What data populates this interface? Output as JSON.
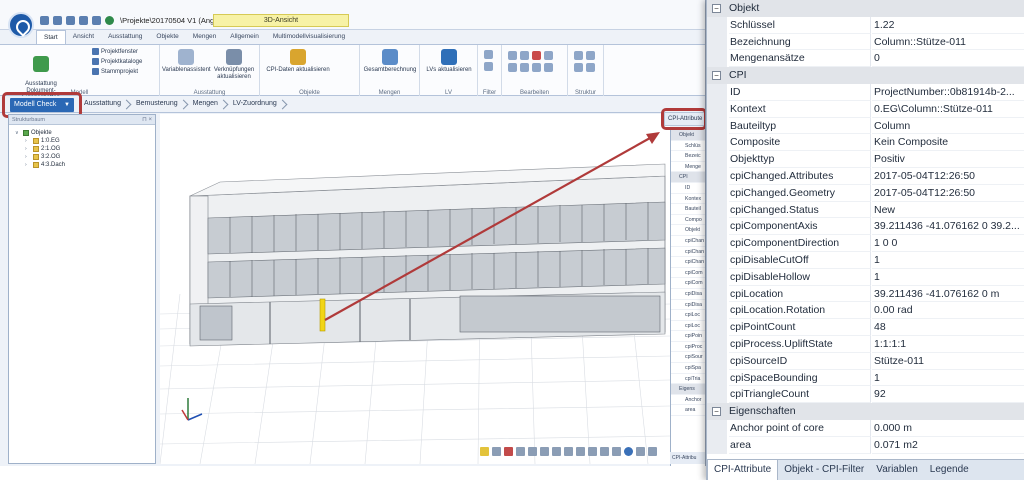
{
  "window": {
    "doc_title": "\\Projekte\\20170504 V1 (Ang...",
    "context_tab": "3D-Ansicht"
  },
  "ribbon": {
    "tabs": [
      "Start",
      "Ansicht",
      "Ausstattung",
      "Objekte",
      "Mengen",
      "Allgemein",
      "Multimodellvisualisierung"
    ],
    "groups": {
      "modell": {
        "label": "Modell",
        "big_button": "Ausstattung\nDokument-Eigenschaften",
        "small": [
          "Projektfenster",
          "Projektkataloge",
          "Stammprojekt"
        ]
      },
      "ausstattung": {
        "label": "Ausstattung",
        "buttons": [
          "Variablenassistent",
          "Verknüpfungen aktualisieren"
        ]
      },
      "objekte": {
        "label": "Objekte",
        "buttons": [
          "CPI-Daten aktualisieren"
        ]
      },
      "mengen": {
        "label": "Mengen",
        "buttons": [
          "Gesamtberechnung"
        ]
      },
      "lv": {
        "label": "LV",
        "buttons": [
          "LVs aktualisieren"
        ]
      },
      "filter": {
        "label": "Filter"
      },
      "bearbeiten": {
        "label": "Bearbeiten"
      },
      "struktur": {
        "label": "Struktur"
      }
    }
  },
  "breadcrumb": {
    "current": "Modell Check",
    "steps": [
      "Ausstattung",
      "Bemusterung",
      "Mengen",
      "LV-Zuordnung"
    ]
  },
  "structure_panel": {
    "title": "Strukturbaum",
    "root": "Objekte",
    "items": [
      "1:0.EG",
      "2:1.OG",
      "3:2.OG",
      "4:3.Dach"
    ]
  },
  "cpi_mini": {
    "title": "CPI-Attribute",
    "rows": [
      "Objekt",
      "Schlüs",
      "Bezeic",
      "Menge",
      "CPI",
      "ID",
      "Kontex",
      "Bauteil",
      "Compo",
      "Objekt",
      "cpiChan",
      "cpiChan",
      "cpiChan",
      "cpiCom",
      "cpiCom",
      "cpiDisa",
      "cpiDisa",
      "cpiLoc",
      "cpiLoc",
      "cpiPoin",
      "cpiProc",
      "cpiSour",
      "cpiSpa",
      "cpiTria",
      "Eigens",
      "Anchor",
      "area"
    ],
    "footer": "CPI-Attribu"
  },
  "property_grid": {
    "sections": [
      {
        "title": "Objekt",
        "rows": [
          {
            "key": "Schlüssel",
            "value": "1.22"
          },
          {
            "key": "Bezeichnung",
            "value": "Column::Stütze-011"
          },
          {
            "key": "Mengenansätze",
            "value": "0"
          }
        ]
      },
      {
        "title": "CPI",
        "rows": [
          {
            "key": "ID",
            "value": "ProjectNumber::0b81914b-2..."
          },
          {
            "key": "Kontext",
            "value": "0.EG\\Column::Stütze-011"
          },
          {
            "key": "Bauteiltyp",
            "value": "Column"
          },
          {
            "key": "Composite",
            "value": "Kein Composite"
          },
          {
            "key": "Objekttyp",
            "value": "Positiv"
          },
          {
            "key": "cpiChanged.Attributes",
            "value": "2017-05-04T12:26:50"
          },
          {
            "key": "cpiChanged.Geometry",
            "value": "2017-05-04T12:26:50"
          },
          {
            "key": "cpiChanged.Status",
            "value": "New"
          },
          {
            "key": "cpiComponentAxis",
            "value": "39.211436 -41.076162 0 39.2..."
          },
          {
            "key": "cpiComponentDirection",
            "value": "1 0 0"
          },
          {
            "key": "cpiDisableCutOff",
            "value": "1"
          },
          {
            "key": "cpiDisableHollow",
            "value": "1"
          },
          {
            "key": "cpiLocation",
            "value": "39.211436 -41.076162 0 m"
          },
          {
            "key": "cpiLocation.Rotation",
            "value": "0.00 rad"
          },
          {
            "key": "cpiPointCount",
            "value": "48"
          },
          {
            "key": "cpiProcess.UpliftState",
            "value": "1:1:1:1"
          },
          {
            "key": "cpiSourceID",
            "value": "Stütze-011"
          },
          {
            "key": "cpiSpaceBounding",
            "value": "1"
          },
          {
            "key": "cpiTriangleCount",
            "value": "92"
          }
        ]
      },
      {
        "title": "Eigenschaften",
        "rows": [
          {
            "key": "Anchor point of core",
            "value": "0.000 m"
          },
          {
            "key": "area",
            "value": "0.071 m2"
          }
        ]
      }
    ],
    "tabs": [
      "CPI-Attribute",
      "Objekt - CPI-Filter",
      "Variablen",
      "Legende"
    ]
  },
  "colors": {
    "accent": "#2b68b5",
    "highlight": "#b03a3a",
    "selected_column": "#f2d516"
  }
}
